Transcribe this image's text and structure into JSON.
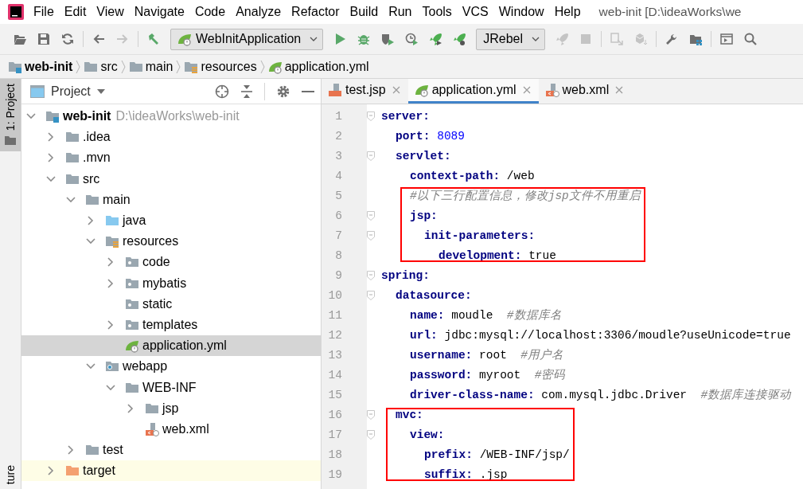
{
  "menu": [
    {
      "label": "File"
    },
    {
      "label": "Edit"
    },
    {
      "label": "View"
    },
    {
      "label": "Navigate"
    },
    {
      "label": "Code"
    },
    {
      "label": "Analyze"
    },
    {
      "label": "Refactor"
    },
    {
      "label": "Build"
    },
    {
      "label": "Run"
    },
    {
      "label": "Tools"
    },
    {
      "label": "VCS"
    },
    {
      "label": "Window"
    },
    {
      "label": "Help"
    }
  ],
  "window": {
    "title": "web-init [D:\\ideaWorks\\we"
  },
  "toolbar": [
    {
      "kind": "open",
      "disabled": false
    },
    {
      "kind": "save",
      "disabled": false
    },
    {
      "kind": "sync",
      "disabled": false
    },
    {
      "kind": "separator"
    },
    {
      "kind": "back",
      "disabled": false
    },
    {
      "kind": "forward",
      "disabled": true
    },
    {
      "kind": "separator"
    },
    {
      "kind": "build",
      "disabled": false
    },
    {
      "kind": "run-config",
      "label": "WebInitApplication"
    },
    {
      "kind": "run",
      "disabled": false
    },
    {
      "kind": "debug",
      "disabled": false
    },
    {
      "kind": "coverage",
      "disabled": false
    },
    {
      "kind": "profile",
      "disabled": false
    },
    {
      "kind": "rocket",
      "disabled": false
    },
    {
      "kind": "rocket-debug",
      "disabled": false
    },
    {
      "kind": "dropdown",
      "label": "JRebel"
    },
    {
      "kind": "rocket",
      "disabled": true
    },
    {
      "kind": "stop",
      "disabled": true
    },
    {
      "kind": "separator"
    },
    {
      "kind": "update",
      "disabled": true
    },
    {
      "kind": "cubes",
      "disabled": true
    },
    {
      "kind": "separator"
    },
    {
      "kind": "wrench",
      "disabled": false
    },
    {
      "kind": "structure",
      "disabled": false
    },
    {
      "kind": "separator"
    },
    {
      "kind": "terminal",
      "disabled": false
    },
    {
      "kind": "search",
      "disabled": false
    }
  ],
  "breadcrumb": [
    {
      "label": "web-init",
      "kind": "module"
    },
    {
      "label": "src",
      "kind": "folder"
    },
    {
      "label": "main",
      "kind": "folder"
    },
    {
      "label": "resources",
      "kind": "resources"
    },
    {
      "label": "application.yml",
      "kind": "yml"
    }
  ],
  "side_stripe": {
    "top_tab": "1: Project",
    "bottom_tab": "ture"
  },
  "project_panel": {
    "title": "Project",
    "tree": [
      {
        "label": "web-init",
        "path": "D:\\ideaWorks\\web-init",
        "kind": "module",
        "expanded": true,
        "selected": false,
        "ignored": false,
        "children": [
          {
            "label": ".idea",
            "kind": "folder",
            "expanded": false,
            "selected": false,
            "ignored": false
          },
          {
            "label": ".mvn",
            "kind": "folder",
            "expanded": false,
            "selected": false,
            "ignored": false
          },
          {
            "label": "src",
            "kind": "folder",
            "expanded": true,
            "selected": false,
            "ignored": false,
            "children": [
              {
                "label": "main",
                "kind": "folder",
                "expanded": true,
                "selected": false,
                "ignored": false,
                "children": [
                  {
                    "label": "java",
                    "kind": "source",
                    "expanded": false,
                    "selected": false,
                    "ignored": false
                  },
                  {
                    "label": "resources",
                    "kind": "resources",
                    "expanded": true,
                    "selected": false,
                    "ignored": false,
                    "children": [
                      {
                        "label": "code",
                        "kind": "package",
                        "expanded": false,
                        "selected": false,
                        "ignored": false
                      },
                      {
                        "label": "mybatis",
                        "kind": "package",
                        "expanded": false,
                        "selected": false,
                        "ignored": false
                      },
                      {
                        "label": "static",
                        "kind": "package",
                        "selected": false,
                        "ignored": false
                      },
                      {
                        "label": "templates",
                        "kind": "package",
                        "expanded": false,
                        "selected": false,
                        "ignored": false
                      },
                      {
                        "label": "application.yml",
                        "kind": "yml",
                        "selected": true,
                        "ignored": false
                      }
                    ]
                  },
                  {
                    "label": "webapp",
                    "kind": "web",
                    "expanded": true,
                    "selected": false,
                    "ignored": false,
                    "children": [
                      {
                        "label": "WEB-INF",
                        "kind": "folder",
                        "expanded": true,
                        "selected": false,
                        "ignored": false,
                        "children": [
                          {
                            "label": "jsp",
                            "kind": "folder",
                            "expanded": false,
                            "selected": false,
                            "ignored": false
                          },
                          {
                            "label": "web.xml",
                            "kind": "xml",
                            "selected": false,
                            "ignored": false
                          }
                        ]
                      }
                    ]
                  }
                ]
              },
              {
                "label": "test",
                "kind": "folder",
                "expanded": false,
                "selected": false,
                "ignored": false
              }
            ]
          },
          {
            "label": "target",
            "kind": "excluded",
            "expanded": false,
            "selected": false,
            "ignored": true
          }
        ]
      }
    ]
  },
  "editor": {
    "tabs": [
      {
        "label": "test.jsp",
        "kind": "jsp",
        "selected": false
      },
      {
        "label": "application.yml",
        "kind": "yml",
        "selected": true
      },
      {
        "label": "web.xml",
        "kind": "xml",
        "selected": false
      }
    ],
    "code": [
      {
        "number": "1",
        "key": "server:",
        "boxed": false,
        "children": [
          {
            "number": "2",
            "key": "port:",
            "kind": "number",
            "value": "8089",
            "boxed": false
          },
          {
            "number": "3",
            "key": "servlet:",
            "boxed": false,
            "children": [
              {
                "number": "4",
                "key": "context-path:",
                "value": "/web",
                "boxed": false
              },
              {
                "number": "5",
                "comment": "#以下三行配置信息，修改jsp文件不用重启",
                "boxed": true
              },
              {
                "number": "6",
                "key": "jsp:",
                "boxed": true,
                "children": [
                  {
                    "number": "7",
                    "key": "init-parameters:",
                    "boxed": true,
                    "children": [
                      {
                        "number": "8",
                        "key": "development:",
                        "value": "true",
                        "boxed": true
                      }
                    ]
                  }
                ]
              }
            ]
          }
        ]
      },
      {
        "number": "9",
        "key": "spring:",
        "boxed": false,
        "children": [
          {
            "number": "10",
            "key": "datasource:",
            "boxed": false,
            "children": [
              {
                "number": "11",
                "key": "name:",
                "value": "moudle",
                "comment": "#数据库名",
                "boxed": false
              },
              {
                "number": "12",
                "key": "url:",
                "value": "jdbc:mysql://localhost:3306/moudle?useUnicode=true",
                "boxed": false
              },
              {
                "number": "13",
                "key": "username:",
                "value": "root",
                "comment": "#用户名",
                "boxed": false
              },
              {
                "number": "14",
                "key": "password:",
                "value": "myroot",
                "comment": "#密码",
                "boxed": false
              },
              {
                "number": "15",
                "key": "driver-class-name:",
                "value": "com.mysql.jdbc.Driver",
                "comment": "#数据库连接驱动",
                "boxed": false
              }
            ]
          },
          {
            "number": "16",
            "key": "mvc:",
            "boxed": true,
            "children": [
              {
                "number": "17",
                "key": "view:",
                "boxed": true,
                "children": [
                  {
                    "number": "18",
                    "key": "prefix:",
                    "value": "/WEB-INF/jsp/",
                    "boxed": true
                  },
                  {
                    "number": "19",
                    "key": "suffix:",
                    "value": ".jsp",
                    "boxed": true
                  }
                ]
              }
            ]
          }
        ]
      }
    ]
  }
}
